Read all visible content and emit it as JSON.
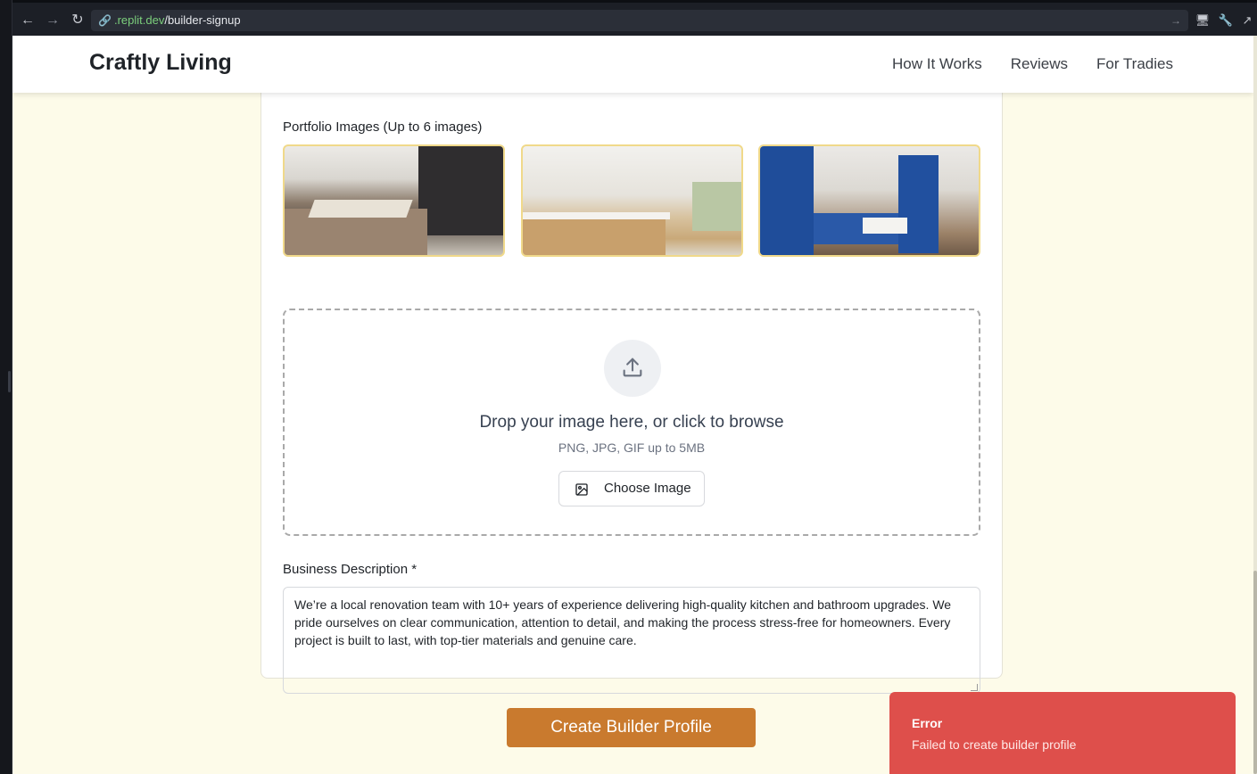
{
  "browser": {
    "url_domain": ".replit.dev",
    "url_path": "/builder-signup"
  },
  "header": {
    "brand": "Craftly Living",
    "nav": [
      "How It Works",
      "Reviews",
      "For Tradies"
    ]
  },
  "portfolio": {
    "label": "Portfolio Images (Up to 6 images)",
    "images": [
      "kitchen-dark-cabinets-image",
      "kitchen-white-wood-island-image",
      "kitchen-blue-cabinets-image"
    ]
  },
  "upload": {
    "title": "Drop your image here, or click to browse",
    "hint": "PNG, JPG, GIF up to 5MB",
    "button": "Choose Image"
  },
  "description": {
    "label": "Business Description *",
    "value": "We’re a local renovation team with 10+ years of experience delivering high-quality kitchen and bathroom upgrades. We pride ourselves on clear communication, attention to detail, and making the process stress-free for homeowners. Every project is built to last, with top-tier materials and genuine care."
  },
  "submit": "Create Builder Profile",
  "toast": {
    "title": "Error",
    "message": "Failed to create builder profile"
  }
}
